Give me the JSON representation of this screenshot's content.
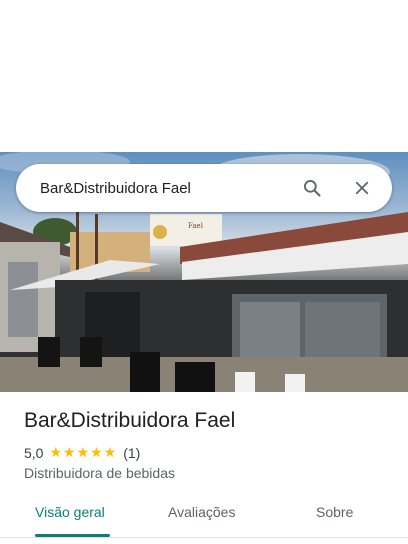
{
  "search": {
    "query": "Bar&Distribuidora Fael"
  },
  "place": {
    "name": "Bar&Distribuidora Fael",
    "rating": "5,0",
    "stars": "★★★★★",
    "review_count": "(1)",
    "category": "Distribuidora de bebidas",
    "rating_color": "#fbbc04"
  },
  "tabs": [
    {
      "label": "Visão geral",
      "active": true
    },
    {
      "label": "Avaliações",
      "active": false
    },
    {
      "label": "Sobre",
      "active": false
    }
  ],
  "colors": {
    "accent": "#0b7d7a"
  },
  "icons": {
    "search": "search-icon",
    "close": "close-icon"
  }
}
